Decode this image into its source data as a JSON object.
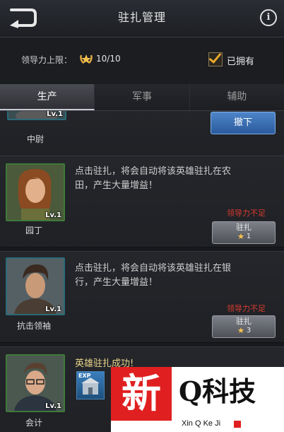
{
  "header": {
    "title": "驻扎管理",
    "back_icon": "back-arrow-icon",
    "info_label": "i"
  },
  "leadership": {
    "label": "领导力上限：",
    "value": "10/10",
    "owned_label": "已拥有",
    "owned_checked": true
  },
  "tabs": [
    {
      "label": "生产",
      "active": true
    },
    {
      "label": "军事",
      "active": false
    },
    {
      "label": "辅助",
      "active": false
    }
  ],
  "heroes": [
    {
      "name": "中尉",
      "level": "Lv.1",
      "action_label": "撤下"
    },
    {
      "name": "园丁",
      "level": "Lv.1",
      "description": "点击驻扎，将会自动将该英雄驻扎在农田，产生大量增益！",
      "warning": "领导力不足",
      "button_label": "驻扎",
      "cost": "1"
    },
    {
      "name": "抗击领袖",
      "level": "Lv.1",
      "description": "点击驻扎，将会自动将该英雄驻扎在银行，产生大量增益！",
      "warning": "领导力不足",
      "button_label": "驻扎",
      "cost": "3"
    },
    {
      "name": "会计",
      "level": "Lv.1",
      "status": "英雄驻扎成功!",
      "item_label": "EXP"
    }
  ],
  "watermark": {
    "seal_char": "新",
    "brand": "Q科技",
    "brand_pinyin": "Xin Q Ke Ji"
  },
  "colors": {
    "warning": "#d83a2f",
    "accent_gold": "#e9a82a",
    "withdraw_blue": "#3a6fb5"
  }
}
